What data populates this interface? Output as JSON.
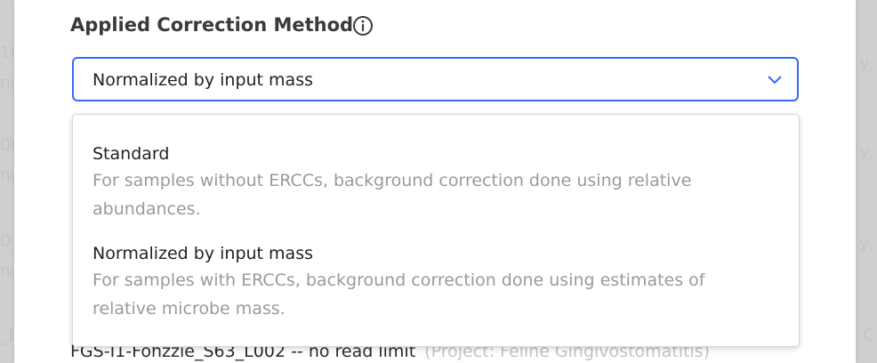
{
  "background": {
    "left_fragments": [
      "10",
      "ng",
      "00",
      "ng",
      "0_",
      "ng",
      "_L"
    ],
    "right_fragments": [
      "y,",
      "y,",
      "y,",
      "C"
    ],
    "selected_sample": {
      "name": "FGS-I1-Fohzzie_S63_L002 -- no read limit",
      "project": "(Project: Feline Gingivostomatitis)"
    }
  },
  "field": {
    "label": "Applied Correction Method",
    "value": "Normalized by input mass"
  },
  "dropdown": {
    "options": [
      {
        "title": "Standard",
        "description": "For samples without ERCCs, background correction done using relative abundances."
      },
      {
        "title": "Normalized by input mass",
        "description": "For samples with ERCCs, background correction done using estimates of relative microbe mass."
      }
    ]
  },
  "colors": {
    "accent": "#3867fa",
    "text": "#222222",
    "muted": "#9a9a9a"
  },
  "icons": {
    "info": "info-circle-icon",
    "caret": "chevron-down-icon"
  }
}
